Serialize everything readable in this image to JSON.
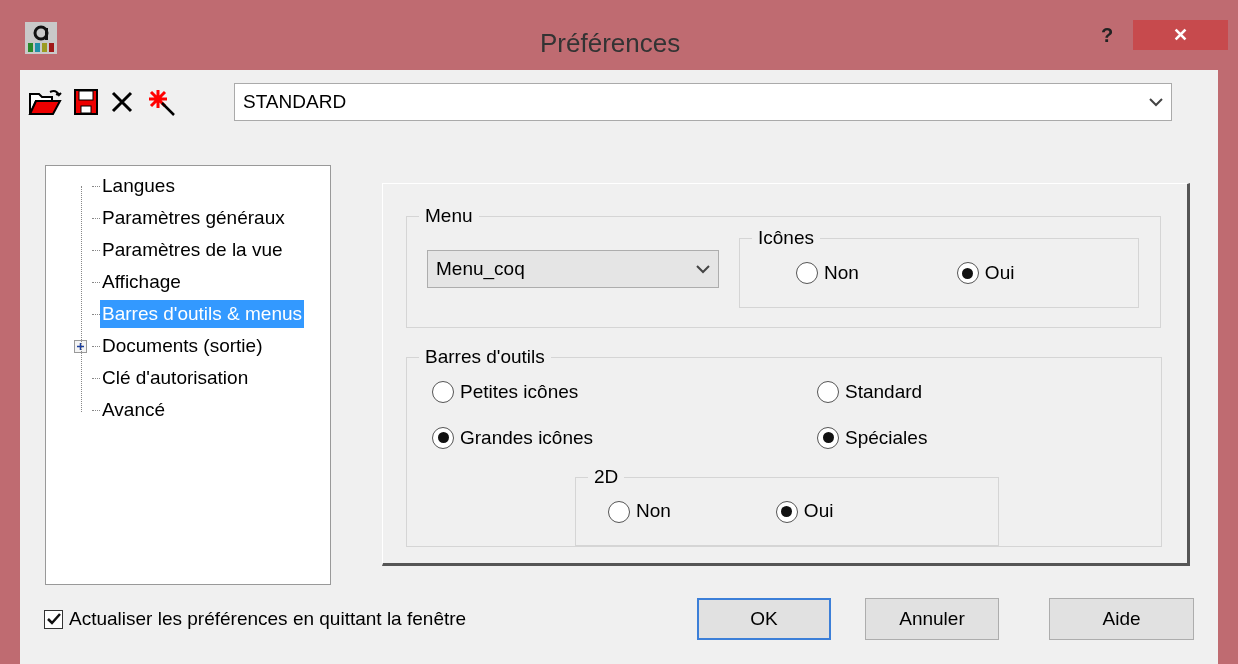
{
  "window": {
    "title": "Préférences",
    "help": "?",
    "close": "✕"
  },
  "profile": {
    "value": "STANDARD"
  },
  "tree": [
    {
      "label": "Langues",
      "selected": false
    },
    {
      "label": "Paramètres généraux",
      "selected": false
    },
    {
      "label": "Paramètres de la vue",
      "selected": false
    },
    {
      "label": "Affichage",
      "selected": false
    },
    {
      "label": "Barres d'outils & menus",
      "selected": true
    },
    {
      "label": "Documents (sortie)",
      "selected": false,
      "expanded": false
    },
    {
      "label": "Clé d'autorisation",
      "selected": false
    },
    {
      "label": "Avancé",
      "selected": false
    }
  ],
  "menu_group": {
    "title": "Menu",
    "dropdown": "Menu_coq",
    "icons_group": {
      "title": "Icônes",
      "options": [
        {
          "label": "Non",
          "selected": false
        },
        {
          "label": "Oui",
          "selected": true
        }
      ]
    }
  },
  "toolbars_group": {
    "title": "Barres d'outils",
    "size_options": [
      {
        "label": "Petites icônes",
        "selected": false
      },
      {
        "label": "Grandes icônes",
        "selected": true
      }
    ],
    "type_options": [
      {
        "label": "Standard",
        "selected": false
      },
      {
        "label": "Spéciales",
        "selected": true
      }
    ],
    "group_2d": {
      "title": "2D",
      "options": [
        {
          "label": "Non",
          "selected": false
        },
        {
          "label": "Oui",
          "selected": true
        }
      ]
    }
  },
  "update_on_close": {
    "label": "Actualiser les préférences en quittant la fenêtre",
    "checked": true
  },
  "buttons": [
    {
      "label": "OK",
      "default": true
    },
    {
      "label": "Annuler",
      "default": false
    },
    {
      "label": "Aide",
      "default": false
    }
  ]
}
